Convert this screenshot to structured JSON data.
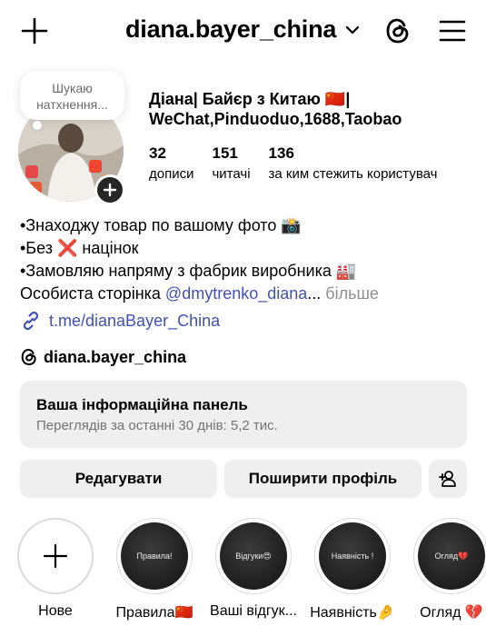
{
  "header": {
    "username": "diana.bayer_china"
  },
  "note": {
    "line1": "Шукаю",
    "line2": "натхнення..."
  },
  "profile": {
    "full_name_line1": "Діана| Байєр з Китаю 🇨🇳|",
    "full_name_line2": "WeChat,Pinduoduo,1688,Taobao",
    "stats": [
      {
        "value": "32",
        "label": "дописи"
      },
      {
        "value": "151",
        "label": "читачі"
      },
      {
        "value": "136",
        "label": "за ким стежить користувач"
      }
    ]
  },
  "bio": {
    "line1": "•Знаходжу товар по вашому фото 📸",
    "line2": "•Без ❌ націнок",
    "line3": "•Замовляю напряму з фабрик виробника 🏭",
    "line4_prefix": "Особиста сторінка ",
    "line4_mention": "@dmytrenko_diana",
    "line4_ellipsis": "...",
    "more": " більше",
    "link": "t.me/dianaBayer_China",
    "threads_handle": "diana.bayer_china"
  },
  "dashboard": {
    "title": "Ваша інформаційна панель",
    "subtitle": "Переглядів за останні 30 днів: 5,2 тис."
  },
  "buttons": {
    "edit": "Редагувати",
    "share": "Поширити профіль"
  },
  "highlights": [
    {
      "label": "Нове",
      "cover_text": ""
    },
    {
      "label": "Правила🇨🇳",
      "cover_text": "Правила!"
    },
    {
      "label": "Ваші відгук...",
      "cover_text": "Відгуки😍"
    },
    {
      "label": "Наявність🤌",
      "cover_text": "Наявність !"
    },
    {
      "label": "Огляд 💔",
      "cover_text": "Огляд💔"
    }
  ],
  "colors": {
    "link": "#3f51b5",
    "muted": "#737373",
    "panel": "#efefef"
  }
}
